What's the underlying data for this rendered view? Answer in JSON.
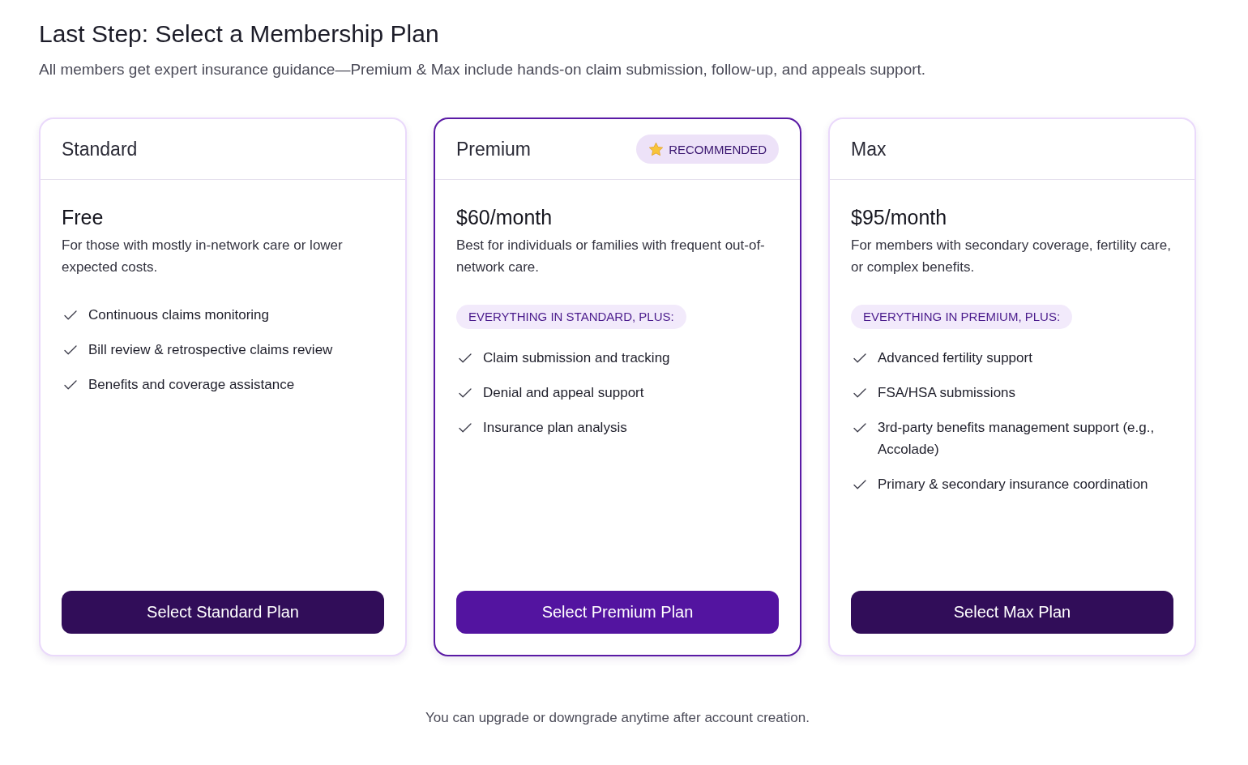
{
  "page": {
    "title": "Last Step: Select a Membership Plan",
    "subtitle": "All members get expert insurance guidance—Premium & Max include hands-on claim submission, follow-up, and appeals support."
  },
  "plans": [
    {
      "name": "Standard",
      "recommended": false,
      "price": "Free",
      "description": "For those with mostly in-network care or lower expected costs.",
      "features": [
        "Continuous claims monitoring",
        "Bill review & retrospective claims review",
        "Benefits and coverage assistance"
      ],
      "button": "Select Standard Plan"
    },
    {
      "name": "Premium",
      "recommended": true,
      "badge": "RECOMMENDED",
      "price": "$60/month",
      "description": "Best for individuals or families with frequent out-of-network care.",
      "includes": "EVERYTHING IN STANDARD, PLUS:",
      "features": [
        "Claim submission and tracking",
        "Denial and appeal support",
        "Insurance plan analysis"
      ],
      "button": "Select Premium Plan"
    },
    {
      "name": "Max",
      "recommended": false,
      "price": "$95/month",
      "description": "For members with secondary coverage, fertility care, or complex benefits.",
      "includes": "EVERYTHING IN PREMIUM, PLUS:",
      "features": [
        "Advanced fertility support",
        "FSA/HSA submissions",
        "3rd-party benefits management support (e.g., Accolade)",
        "Primary & secondary insurance coordination"
      ],
      "button": "Select Max Plan"
    }
  ],
  "footer": "You can upgrade or downgrade anytime after account creation."
}
